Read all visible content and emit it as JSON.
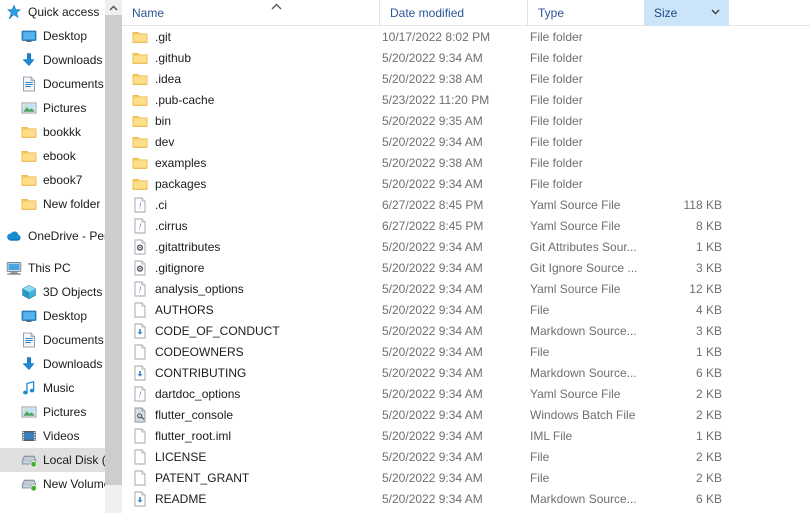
{
  "sidebar": {
    "items": [
      {
        "label": "Quick access",
        "icon": "quick-access-star-icon",
        "level": 0,
        "pin": false,
        "selected": false,
        "gap_before": false
      },
      {
        "label": "Desktop",
        "icon": "desktop-monitor-icon",
        "level": 1,
        "pin": true,
        "selected": false,
        "gap_before": false
      },
      {
        "label": "Downloads",
        "icon": "downloads-arrow-icon",
        "level": 1,
        "pin": true,
        "selected": false,
        "gap_before": false
      },
      {
        "label": "Documents",
        "icon": "documents-icon",
        "level": 1,
        "pin": true,
        "selected": false,
        "gap_before": false
      },
      {
        "label": "Pictures",
        "icon": "pictures-icon",
        "level": 1,
        "pin": true,
        "selected": false,
        "gap_before": false
      },
      {
        "label": "bookkk",
        "icon": "folder-icon",
        "level": 1,
        "pin": false,
        "selected": false,
        "gap_before": false
      },
      {
        "label": "ebook",
        "icon": "folder-icon",
        "level": 1,
        "pin": false,
        "selected": false,
        "gap_before": false
      },
      {
        "label": "ebook7",
        "icon": "folder-icon",
        "level": 1,
        "pin": false,
        "selected": false,
        "gap_before": false
      },
      {
        "label": "New folder",
        "icon": "folder-icon",
        "level": 1,
        "pin": false,
        "selected": false,
        "gap_before": false
      },
      {
        "label": "OneDrive - Personal",
        "icon": "onedrive-cloud-icon",
        "level": 0,
        "pin": false,
        "selected": false,
        "gap_before": true
      },
      {
        "label": "This PC",
        "icon": "this-pc-icon",
        "level": 0,
        "pin": false,
        "selected": false,
        "gap_before": true
      },
      {
        "label": "3D Objects",
        "icon": "3d-objects-icon",
        "level": 1,
        "pin": false,
        "selected": false,
        "gap_before": false
      },
      {
        "label": "Desktop",
        "icon": "desktop-monitor-icon",
        "level": 1,
        "pin": false,
        "selected": false,
        "gap_before": false
      },
      {
        "label": "Documents",
        "icon": "documents-icon",
        "level": 1,
        "pin": false,
        "selected": false,
        "gap_before": false
      },
      {
        "label": "Downloads",
        "icon": "downloads-arrow-icon",
        "level": 1,
        "pin": false,
        "selected": false,
        "gap_before": false
      },
      {
        "label": "Music",
        "icon": "music-note-icon",
        "level": 1,
        "pin": false,
        "selected": false,
        "gap_before": false
      },
      {
        "label": "Pictures",
        "icon": "pictures-icon",
        "level": 1,
        "pin": false,
        "selected": false,
        "gap_before": false
      },
      {
        "label": "Videos",
        "icon": "videos-icon",
        "level": 1,
        "pin": false,
        "selected": false,
        "gap_before": false
      },
      {
        "label": "Local Disk (C:)",
        "icon": "drive-icon",
        "level": 1,
        "pin": false,
        "selected": true,
        "gap_before": false
      },
      {
        "label": "New Volume (D:)",
        "icon": "drive-icon",
        "level": 1,
        "pin": false,
        "selected": false,
        "gap_before": false
      }
    ],
    "scroll_up_icon": "chevron-up-icon"
  },
  "columns": {
    "name": "Name",
    "date_modified": "Date modified",
    "type": "Type",
    "size": "Size",
    "size_dropdown_icon": "chevron-down-icon",
    "sort_indicator_icon": "sort-ascending-caret-icon"
  },
  "files": [
    {
      "name": ".git",
      "date": "10/17/2022 8:02 PM",
      "type": "File folder",
      "size": "",
      "icon": "folder-icon"
    },
    {
      "name": ".github",
      "date": "5/20/2022 9:34 AM",
      "type": "File folder",
      "size": "",
      "icon": "folder-icon"
    },
    {
      "name": ".idea",
      "date": "5/20/2022 9:38 AM",
      "type": "File folder",
      "size": "",
      "icon": "folder-icon"
    },
    {
      "name": ".pub-cache",
      "date": "5/23/2022 11:20 PM",
      "type": "File folder",
      "size": "",
      "icon": "folder-icon"
    },
    {
      "name": "bin",
      "date": "5/20/2022 9:35 AM",
      "type": "File folder",
      "size": "",
      "icon": "folder-icon"
    },
    {
      "name": "dev",
      "date": "5/20/2022 9:34 AM",
      "type": "File folder",
      "size": "",
      "icon": "folder-icon"
    },
    {
      "name": "examples",
      "date": "5/20/2022 9:38 AM",
      "type": "File folder",
      "size": "",
      "icon": "folder-icon"
    },
    {
      "name": "packages",
      "date": "5/20/2022 9:34 AM",
      "type": "File folder",
      "size": "",
      "icon": "folder-icon"
    },
    {
      "name": ".ci",
      "date": "6/27/2022 8:45 PM",
      "type": "Yaml Source File",
      "size": "118 KB",
      "icon": "yaml-file-icon"
    },
    {
      "name": ".cirrus",
      "date": "6/27/2022 8:45 PM",
      "type": "Yaml Source File",
      "size": "8 KB",
      "icon": "yaml-file-icon"
    },
    {
      "name": ".gitattributes",
      "date": "5/20/2022 9:34 AM",
      "type": "Git Attributes Sour...",
      "size": "1 KB",
      "icon": "git-config-file-icon"
    },
    {
      "name": ".gitignore",
      "date": "5/20/2022 9:34 AM",
      "type": "Git Ignore Source ...",
      "size": "3 KB",
      "icon": "git-config-file-icon"
    },
    {
      "name": "analysis_options",
      "date": "5/20/2022 9:34 AM",
      "type": "Yaml Source File",
      "size": "12 KB",
      "icon": "yaml-file-icon"
    },
    {
      "name": "AUTHORS",
      "date": "5/20/2022 9:34 AM",
      "type": "File",
      "size": "4 KB",
      "icon": "blank-file-icon"
    },
    {
      "name": "CODE_OF_CONDUCT",
      "date": "5/20/2022 9:34 AM",
      "type": "Markdown Source...",
      "size": "3 KB",
      "icon": "markdown-file-icon"
    },
    {
      "name": "CODEOWNERS",
      "date": "5/20/2022 9:34 AM",
      "type": "File",
      "size": "1 KB",
      "icon": "blank-file-icon"
    },
    {
      "name": "CONTRIBUTING",
      "date": "5/20/2022 9:34 AM",
      "type": "Markdown Source...",
      "size": "6 KB",
      "icon": "markdown-file-icon"
    },
    {
      "name": "dartdoc_options",
      "date": "5/20/2022 9:34 AM",
      "type": "Yaml Source File",
      "size": "2 KB",
      "icon": "yaml-file-icon"
    },
    {
      "name": "flutter_console",
      "date": "5/20/2022 9:34 AM",
      "type": "Windows Batch File",
      "size": "2 KB",
      "icon": "batch-file-icon"
    },
    {
      "name": "flutter_root.iml",
      "date": "5/20/2022 9:34 AM",
      "type": "IML File",
      "size": "1 KB",
      "icon": "blank-file-icon"
    },
    {
      "name": "LICENSE",
      "date": "5/20/2022 9:34 AM",
      "type": "File",
      "size": "2 KB",
      "icon": "blank-file-icon"
    },
    {
      "name": "PATENT_GRANT",
      "date": "5/20/2022 9:34 AM",
      "type": "File",
      "size": "2 KB",
      "icon": "blank-file-icon"
    },
    {
      "name": "README",
      "date": "5/20/2022 9:34 AM",
      "type": "Markdown Source...",
      "size": "6 KB",
      "icon": "markdown-file-icon"
    }
  ],
  "colors": {
    "folder_yellow": "#ffd866",
    "accent_blue": "#0078d7",
    "header_text": "#2a5598",
    "active_column_bg": "#cce4f7",
    "selection_gray": "#e0e0e0",
    "secondary_text": "#6f6f6f"
  }
}
